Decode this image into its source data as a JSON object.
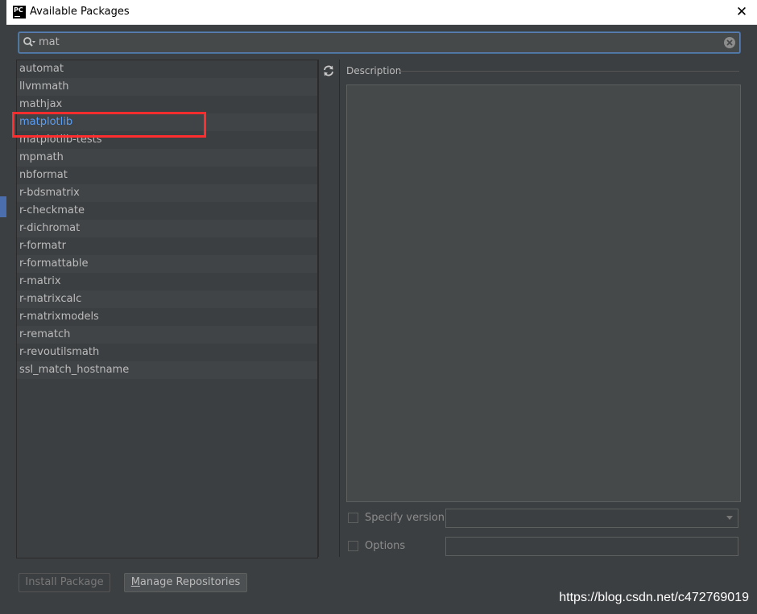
{
  "window": {
    "title": "Available Packages",
    "app_icon_text": "PC",
    "close_glyph": "✕"
  },
  "search": {
    "value": "mat",
    "placeholder": ""
  },
  "packages": [
    "automat",
    "llvmmath",
    "mathjax",
    "matplotlib",
    "matplotlib-tests",
    "mpmath",
    "nbformat",
    "r-bdsmatrix",
    "r-checkmate",
    "r-dichromat",
    "r-formatr",
    "r-formattable",
    "r-matrix",
    "r-matrixcalc",
    "r-matrixmodels",
    "r-rematch",
    "r-revoutilsmath",
    "ssl_match_hostname"
  ],
  "selected_package": "matplotlib",
  "description": {
    "label": "Description",
    "text": ""
  },
  "options": {
    "specify_version_label": "Specify version",
    "specify_version_checked": false,
    "version_value": "",
    "options_label": "Options",
    "options_checked": false,
    "options_value": ""
  },
  "buttons": {
    "install": "Install Package",
    "manage_mnemonic": "M",
    "manage_rest": "anage Repositories"
  },
  "watermark": "https://blog.csdn.net/c472769019",
  "colors": {
    "accent": "#589df6",
    "highlight_box": "#ff2d2d",
    "background": "#3c3f41"
  },
  "icons": {
    "search": "search-icon",
    "clear": "clear-search-icon",
    "refresh": "refresh-icon",
    "close": "close-icon"
  }
}
